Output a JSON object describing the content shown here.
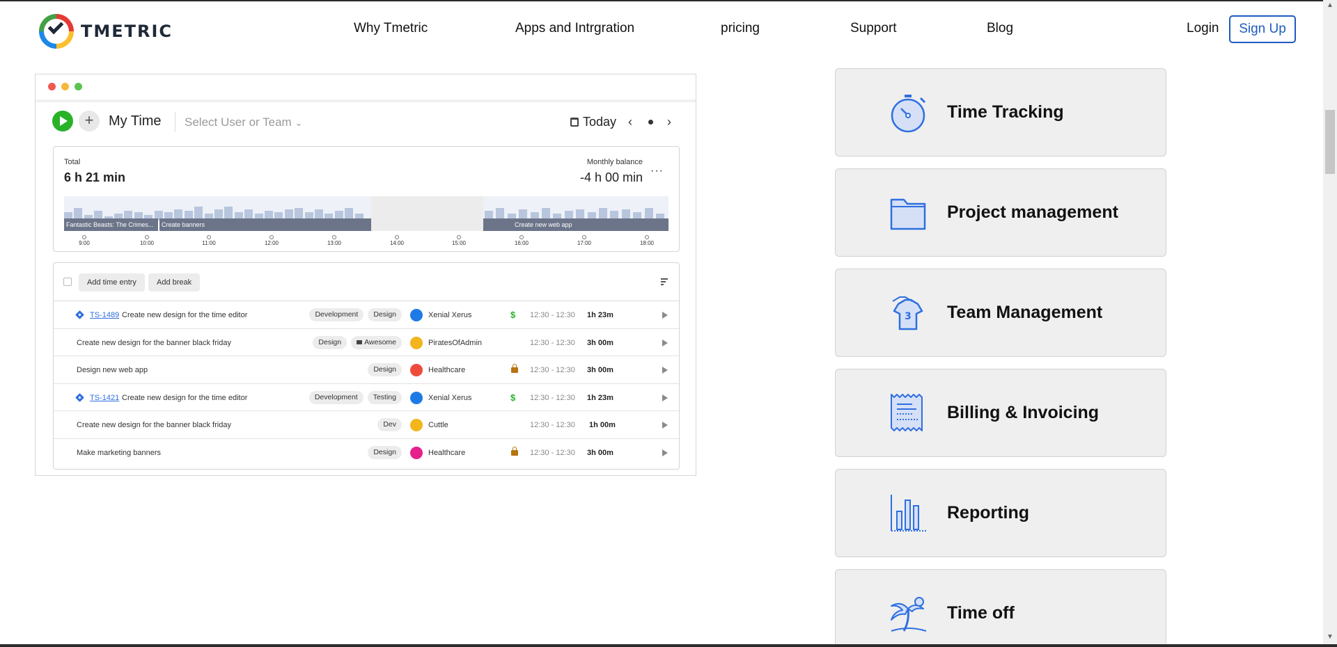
{
  "brand": {
    "name": "TMETRIC"
  },
  "nav": {
    "items": [
      "Why Tmetric",
      "Apps and Intrgration",
      "pricing",
      "Support",
      "Blog"
    ],
    "login": "Login",
    "signup": "Sign Up"
  },
  "app": {
    "window_dots": [
      "#ee5a52",
      "#f5b93a",
      "#5cc44e"
    ],
    "title": "My Time",
    "plus": "+",
    "select_user": "Select User or Team",
    "select_caret": "⌄",
    "date_label": "Today",
    "prev": "‹",
    "next": "›",
    "summary": {
      "total_label": "Total",
      "total_value": "6 h 21 min",
      "balance_label": "Monthly balance",
      "balance_value": "-4 h 00 min",
      "more": "···"
    },
    "timeline": {
      "tasks": [
        "Fantastic Beasts: The Crimes...",
        "Create banners",
        "Create new web app"
      ],
      "ticks": [
        "9:00",
        "10:00",
        "11:00",
        "12:00",
        "13:00",
        "14:00",
        "15:00",
        "16:00",
        "17:00",
        "18:00"
      ]
    },
    "entries_header": {
      "add_entry": "Add time entry",
      "add_break": "Add break"
    },
    "entries": [
      {
        "ticket": "TS-1489",
        "desc": "Create new design for the time editor",
        "tags": [
          "Development",
          "Design"
        ],
        "project": "Xenial Xerus",
        "project_color": "#1e7be6",
        "flag": "billable",
        "billable": "$",
        "range": "12:30  -  12:30",
        "duration": "1h 23m"
      },
      {
        "ticket": "",
        "desc": "Create new design for the banner black friday",
        "tags": [
          "Design",
          "Awesome"
        ],
        "project": "PiratesOfAdmin",
        "project_color": "#f2b51c",
        "flag": "",
        "billable": "",
        "range": "12:30  -  12:30",
        "duration": "3h 00m"
      },
      {
        "ticket": "",
        "desc": "Design new web app",
        "tags": [
          "Design"
        ],
        "project": "Healthcare",
        "project_color": "#ef4b3c",
        "flag": "lock",
        "billable": "",
        "range": "12:30  -  12:30",
        "duration": "3h 00m"
      },
      {
        "ticket": "TS-1421",
        "desc": "Create new design for the time editor",
        "tags": [
          "Development",
          "Testing"
        ],
        "project": "Xenial Xerus",
        "project_color": "#1e7be6",
        "flag": "billable",
        "billable": "$",
        "range": "12:30  -  12:30",
        "duration": "1h 23m"
      },
      {
        "ticket": "",
        "desc": "Create new design for the banner black friday",
        "tags": [
          "Dev"
        ],
        "project": "Cuttle",
        "project_color": "#f2b51c",
        "flag": "",
        "billable": "",
        "range": "12:30  -  12:30",
        "duration": "1h 00m"
      },
      {
        "ticket": "",
        "desc": "Make marketing banners",
        "tags": [
          "Design"
        ],
        "project": "Healthcare",
        "project_color": "#e6218c",
        "flag": "lock",
        "billable": "",
        "range": "12:30  -  12:30",
        "duration": "3h 00m"
      }
    ]
  },
  "features": [
    {
      "title": "Time Tracking",
      "icon": "stopwatch-icon"
    },
    {
      "title": "Project management",
      "icon": "folder-icon"
    },
    {
      "title": "Team Management",
      "icon": "team-shirt-icon"
    },
    {
      "title": "Billing & Invoicing",
      "icon": "receipt-icon"
    },
    {
      "title": "Reporting",
      "icon": "bar-chart-icon"
    },
    {
      "title": "Time off",
      "icon": "palm-tree-icon"
    }
  ],
  "colors": {
    "accent": "#1d5bbf",
    "icon_blue": "#2f6fe0",
    "play_green": "#28b228"
  }
}
